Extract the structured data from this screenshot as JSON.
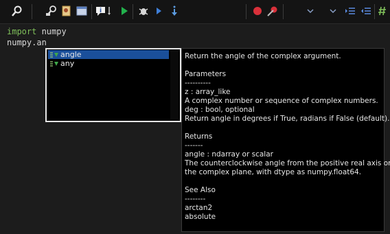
{
  "toolbar": {
    "icons": [
      "search-icon",
      "find-replace-icon",
      "file-icon",
      "window-icon",
      "info-icon",
      "run-icon",
      "debug-bug-icon",
      "step-over-icon",
      "step-into-icon",
      "stop-icon",
      "clear-breakpoint-icon",
      "indent-icon",
      "dedent-icon",
      "comment-icon"
    ]
  },
  "editor": {
    "line1": {
      "keyword": "import",
      "rest": " numpy"
    },
    "line2": "numpy.an"
  },
  "autocomplete": {
    "items": [
      {
        "label": "angle",
        "selected": true,
        "icon": "function-icon"
      },
      {
        "label": "any",
        "selected": false,
        "icon": "function-icon"
      }
    ]
  },
  "doc": {
    "lines": [
      "Return the angle of the complex argument.",
      "",
      "Parameters",
      "----------",
      "z : array_like",
      "    A complex number or sequence of complex numbers.",
      "deg : bool, optional",
      "    Return angle in degrees if True, radians if False (default).",
      "",
      "Returns",
      "-------",
      "angle : ndarray or scalar",
      "    The counterclockwise angle from the positive real axis on",
      "    the complex plane, with dtype as numpy.float64.",
      "",
      "See Also",
      "--------",
      "arctan2",
      "absolute"
    ]
  },
  "colors": {
    "selection": "#1a4f9a",
    "keyword": "#7fbf5a",
    "run": "#22b14c",
    "stop": "#d9303a"
  }
}
